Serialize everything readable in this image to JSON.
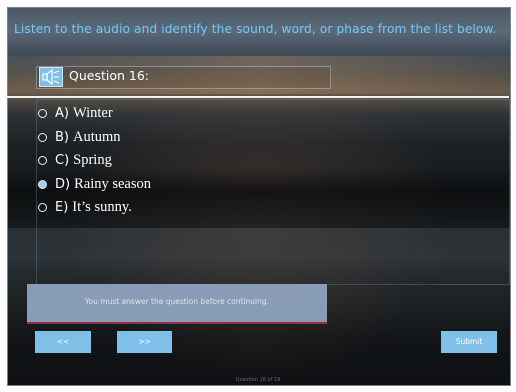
{
  "instruction": "Listen to the audio and identify the sound, word, or phase from the list below.",
  "question": {
    "title": "Question 16:",
    "audio_icon": "speaker-icon"
  },
  "options": [
    {
      "letter": "A)",
      "text": "Winter",
      "selected": false
    },
    {
      "letter": "B)",
      "text": "Autumn",
      "selected": false
    },
    {
      "letter": "C)",
      "text": "Spring",
      "selected": false
    },
    {
      "letter": "D)",
      "text": "Rainy season",
      "selected": true
    },
    {
      "letter": "E)",
      "text": "It’s sunny.",
      "selected": false
    }
  ],
  "warning": {
    "text": "You must answer the question before continuing."
  },
  "nav": {
    "prev_label": "<<",
    "next_label": ">>",
    "submit_label": "Submit"
  },
  "progress": {
    "text": "Question 16 of 19"
  },
  "colors": {
    "accent": "#7fbfe8",
    "instruction": "#6ec9ff",
    "warning_bg": "#8fa3bf",
    "warning_border": "#9b3046"
  }
}
